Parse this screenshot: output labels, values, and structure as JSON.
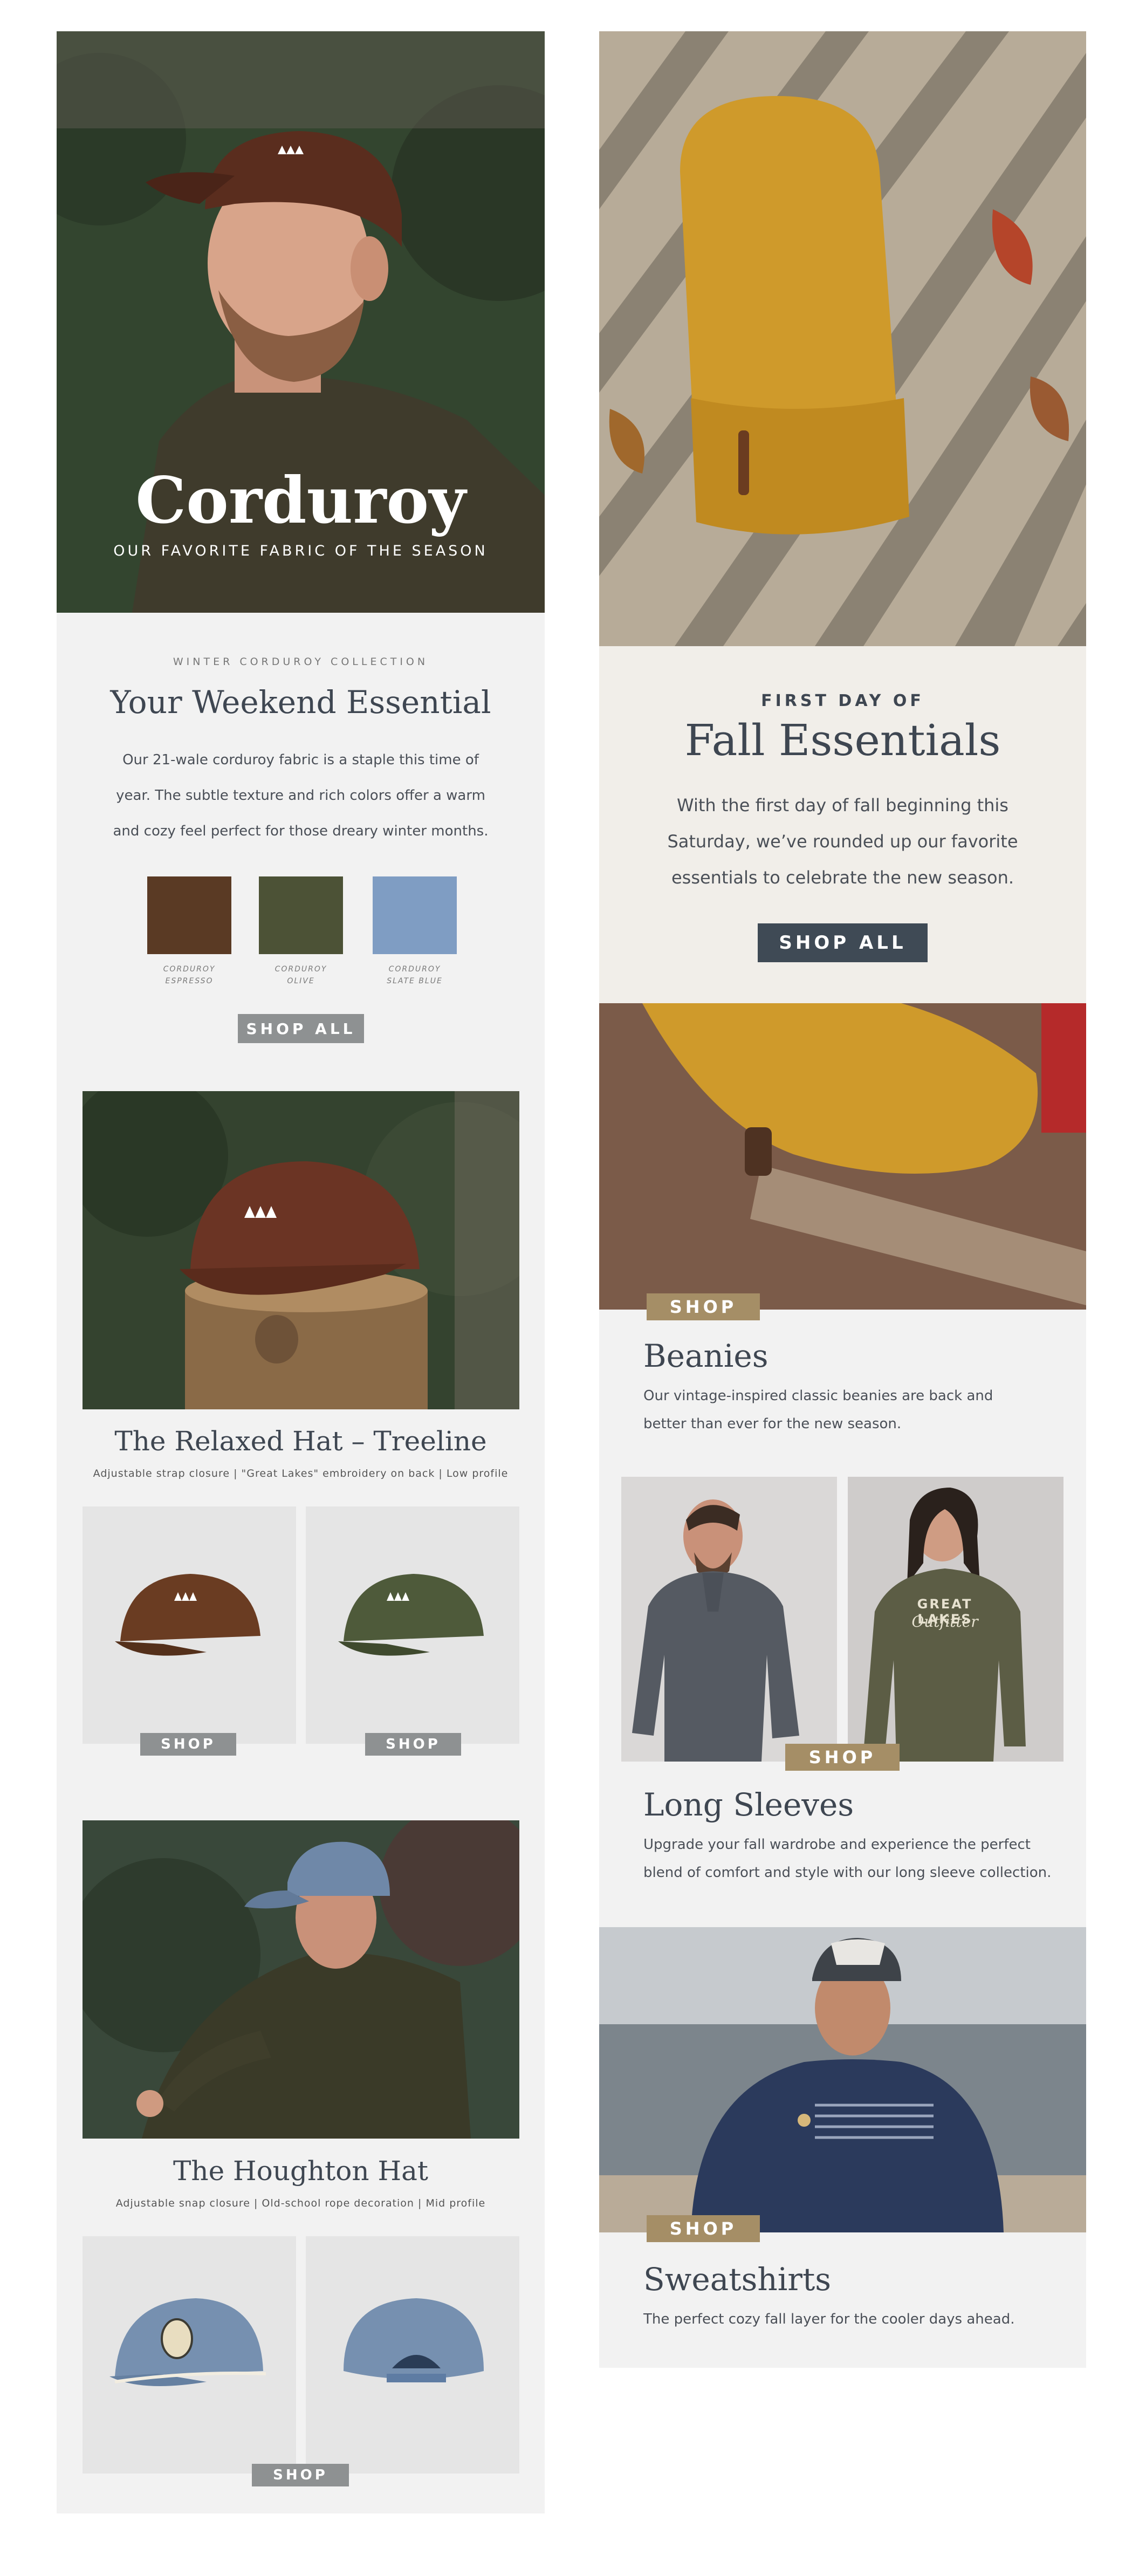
{
  "left": {
    "hero": {
      "title": "Corduroy",
      "subtitle": "OUR FAVORITE FABRIC OF THE SEASON"
    },
    "collection": {
      "eyebrow": "WINTER CORDUROY COLLECTION",
      "heading": "Your Weekend Essential",
      "body_lines": [
        "Our 21-wale corduroy fabric is a staple this time of",
        "year. The subtle texture and rich colors offer a warm",
        "and cozy feel perfect for those dreary winter months."
      ],
      "swatches": [
        {
          "line1": "CORDUROY",
          "line2": "ESPRESSO",
          "color": "#5a3a24"
        },
        {
          "line1": "CORDUROY",
          "line2": "OLIVE",
          "color": "#4c5236"
        },
        {
          "line1": "CORDUROY",
          "line2": "SLATE BLUE",
          "color": "#7f9dc3"
        }
      ],
      "shop_all": "SHOP ALL"
    },
    "relaxed_hat": {
      "title": "The Relaxed Hat – Treeline",
      "details": "Adjustable strap closure | \"Great Lakes\" embroidery on back | Low profile",
      "shop1": "SHOP",
      "shop2": "SHOP"
    },
    "houghton_hat": {
      "title": "The Houghton Hat",
      "details": "Adjustable snap closure | Old-school rope decoration | Mid profile",
      "shop": "SHOP"
    }
  },
  "right": {
    "fall": {
      "eyebrow": "FIRST DAY OF",
      "heading": "Fall Essentials",
      "body_lines": [
        "With the first day of fall beginning this",
        "Saturday, we’ve rounded up our favorite",
        "essentials to celebrate the new season."
      ],
      "shop_all": "SHOP ALL"
    },
    "beanies": {
      "shop": "SHOP",
      "title": "Beanies",
      "body_lines": [
        "Our vintage-inspired classic beanies are back and",
        "better than ever for the new season."
      ]
    },
    "long_sleeves": {
      "shirt_text_line1": "GREAT LAKES",
      "shirt_text_line2": "Outfitter",
      "shop": "SHOP",
      "title": "Long Sleeves",
      "body_lines": [
        "Upgrade your fall wardrobe and experience the perfect",
        "blend of comfort and style with our long sleeve collection."
      ]
    },
    "sweatshirts": {
      "shop": "SHOP",
      "title": "Sweatshirts",
      "body": "The perfect cozy fall layer for the cooler days ahead."
    }
  }
}
